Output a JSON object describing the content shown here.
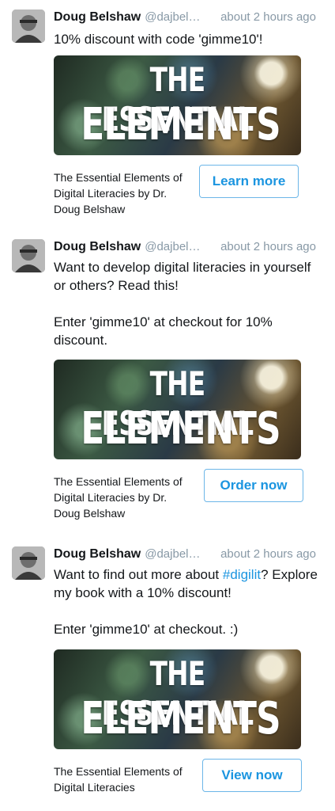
{
  "tweets": [
    {
      "name": "Doug Belshaw",
      "handle": "@dajbel…",
      "time": "about 2 hours ago",
      "lines": [
        "10% discount with code 'gimme10'!"
      ],
      "banner": [
        "THE ESSENTIAL",
        "ELEMENTS"
      ],
      "card_title": "The Essential Elements of Digital Literacies by Dr. Doug Belshaw",
      "cta": "Learn more"
    },
    {
      "name": "Doug Belshaw",
      "handle": "@dajbel…",
      "time": "about 2 hours ago",
      "lines": [
        "Want to develop digital literacies in yourself or others? Read this!",
        "Enter 'gimme10' at checkout for 10% discount."
      ],
      "banner": [
        "THE ESSENTIAL",
        "ELEMENTS"
      ],
      "card_title": "The Essential Elements of Digital Literacies by Dr. Doug Belshaw",
      "cta": "Order now"
    },
    {
      "name": "Doug Belshaw",
      "handle": "@dajbel…",
      "time": "about 2 hours ago",
      "line1_pre": "Want to find out more about ",
      "hashtag": "#digilit",
      "line1_post": "? Explore my book with a 10% discount!",
      "line2": "Enter 'gimme10' at checkout. :)",
      "banner": [
        "THE ESSENTIAL",
        "ELEMENTS"
      ],
      "card_title": "The Essential Elements of Digital Literacies",
      "cta": "View now"
    }
  ],
  "colors": {
    "link": "#1b95e0",
    "meta": "#8899a6",
    "text": "#14171a"
  }
}
